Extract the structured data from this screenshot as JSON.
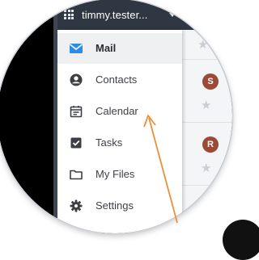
{
  "header": {
    "account_name": "timmy.tester...",
    "icons": {
      "apps": "grid-apps-icon",
      "dropdown": "chevron-down-icon"
    }
  },
  "menu": {
    "items": [
      {
        "label": "Mail",
        "icon": "mail-icon",
        "selected": true
      },
      {
        "label": "Contacts",
        "icon": "contact-icon",
        "selected": false
      },
      {
        "label": "Calendar",
        "icon": "calendar-icon",
        "selected": false
      },
      {
        "label": "Tasks",
        "icon": "checkbox-icon",
        "selected": false
      },
      {
        "label": "My Files",
        "icon": "folder-icon",
        "selected": false
      },
      {
        "label": "Settings",
        "icon": "gear-icon",
        "selected": false
      }
    ]
  },
  "email_list": {
    "avatars": [
      "S",
      "R"
    ]
  },
  "colors": {
    "topbar": "#2f3742",
    "mail_icon": "#2e8be8",
    "annotation_arrow": "#e8913a",
    "avatar": "#9a4a36"
  }
}
